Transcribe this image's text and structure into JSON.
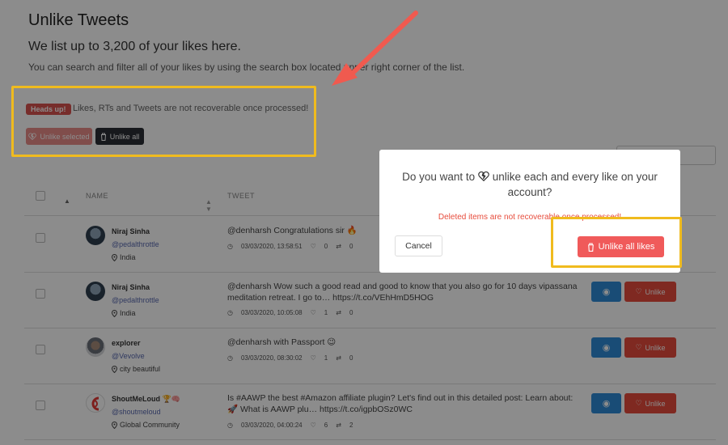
{
  "header": {
    "title": "Unlike Tweets",
    "subtitle": "We list up to 3,200 of your likes here.",
    "description": "You can search and filter all of your likes by using the search box located upper right corner of the list."
  },
  "warning": {
    "badge": "Heads up!",
    "text": "Likes, RTs and Tweets are not recoverable once processed!",
    "unlike_selected_label": "Unlike selected",
    "unlike_all_label": "Unlike all"
  },
  "table": {
    "columns": [
      "NAME",
      "TWEET"
    ],
    "rows": [
      {
        "name": "Niraj Sinha",
        "handle": "@pedalthrottle",
        "location": "India",
        "tweet": "@denharsh Congratulations sir 🔥",
        "date": "03/03/2020, 13:58:51",
        "likes": "0",
        "retweets": "0"
      },
      {
        "name": "Niraj Sinha",
        "handle": "@pedalthrottle",
        "location": "India",
        "tweet": "@denharsh Wow such a good read and good to know that you also go for 10 days vipassana meditation retreat. I go to… https://t.co/VEhHmD5HOG",
        "date": "03/03/2020, 10:05:08",
        "likes": "1",
        "retweets": "0"
      },
      {
        "name": "explorer",
        "handle": "@Vevolve",
        "location": "city beautiful",
        "tweet": "@denharsh with Passport 😉",
        "date": "03/03/2020, 08:30:02",
        "likes": "1",
        "retweets": "0"
      },
      {
        "name": "ShoutMeLoud 🏆🧠",
        "handle": "@shoutmeloud",
        "location": "Global Community",
        "tweet": "Is #AAWP the best #Amazon affiliate plugin? Let's find out in this detailed post: Learn about: 🚀 What is AAWP plu… https://t.co/igpbOSz0WC",
        "date": "03/03/2020, 04:00:24",
        "likes": "6",
        "retweets": "2"
      }
    ],
    "unlike_label": "Unlike"
  },
  "modal": {
    "question_part1": "Do you want to",
    "question_part2": "unlike each and every like on your account?",
    "warning": "Deleted items are not recoverable once processed!",
    "cancel_label": "Cancel",
    "confirm_label": "Unlike all likes"
  },
  "colors": {
    "danger": "#e74c3c",
    "primary": "#2e8ad8",
    "highlight": "#f0bb1e",
    "arrow": "#f05a4f"
  }
}
